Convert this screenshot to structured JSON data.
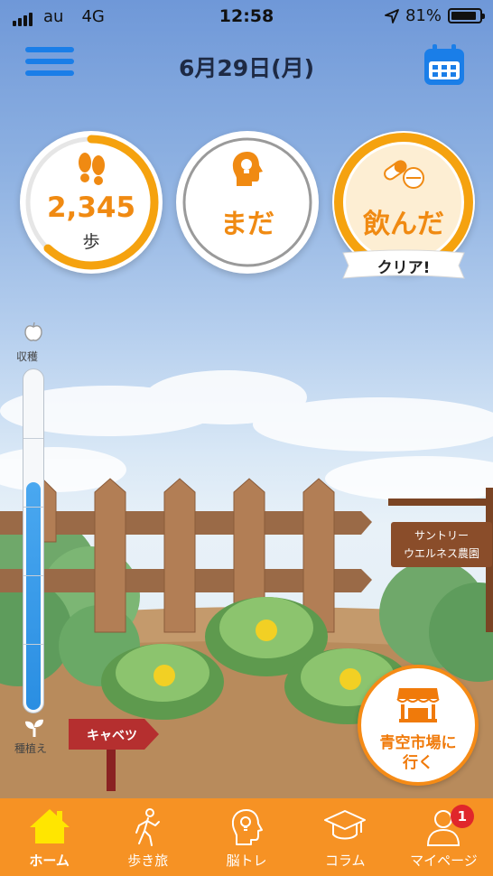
{
  "status_bar": {
    "carrier": "au",
    "network": "4G",
    "time": "12:58",
    "battery": "81%"
  },
  "header": {
    "date": "6月29日(月)"
  },
  "stats": {
    "steps": {
      "value": "2,345",
      "unit": "歩",
      "progress": 0.62
    },
    "brain": {
      "label": "まだ"
    },
    "supplement": {
      "label": "飲んだ",
      "banner": "クリア!"
    }
  },
  "growth_meter": {
    "top_label": "収穫",
    "bottom_label": "種植え",
    "level": 0.67
  },
  "scene": {
    "farm_sign": [
      "サントリー",
      "ウエルネス農園"
    ],
    "crop_sign": "キャベツ"
  },
  "market_button": {
    "label_line1": "青空市場に",
    "label_line2": "行く"
  },
  "tabs": [
    {
      "label": "ホーム",
      "icon": "home-icon",
      "active": true
    },
    {
      "label": "歩き旅",
      "icon": "walker-icon",
      "active": false
    },
    {
      "label": "脳トレ",
      "icon": "brain-icon",
      "active": false
    },
    {
      "label": "コラム",
      "icon": "graduation-cap-icon",
      "active": false
    },
    {
      "label": "マイページ",
      "icon": "person-icon",
      "active": false,
      "badge": "1"
    }
  ],
  "colors": {
    "accent": "#f69224",
    "orange_text": "#f08a12",
    "blue": "#1a7ee8",
    "badge": "#e0262b"
  }
}
